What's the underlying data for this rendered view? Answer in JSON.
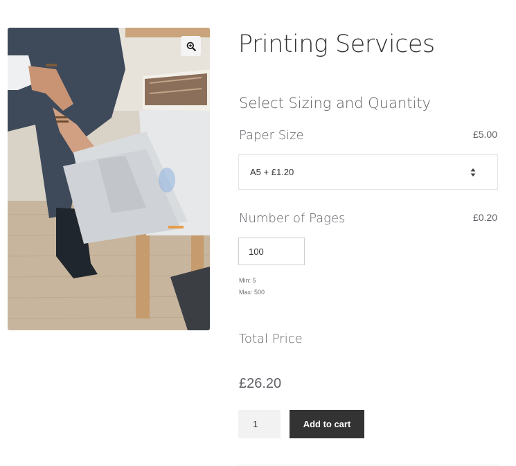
{
  "product": {
    "title": "Printing Services",
    "image_subject": "person-loading-paper-into-printer-photo"
  },
  "options_section": {
    "heading": "Select Sizing and Quantity"
  },
  "paper_size": {
    "label": "Paper Size",
    "price": "£5.00",
    "selected": "A5 + £1.20"
  },
  "pages": {
    "label": "Number of Pages",
    "price": "£0.20",
    "value": "100",
    "min_note": "Min: 5",
    "max_note": "Max: 500"
  },
  "total": {
    "label": "Total Price",
    "price": "£26.20"
  },
  "cart": {
    "quantity": "1",
    "add_label": "Add to cart"
  },
  "colors": {
    "button_bg": "#333333",
    "text": "#43454b",
    "muted": "#5f6066"
  },
  "icons": {
    "zoom": "zoom-in-icon",
    "select_arrows": "sort-arrows-icon"
  }
}
